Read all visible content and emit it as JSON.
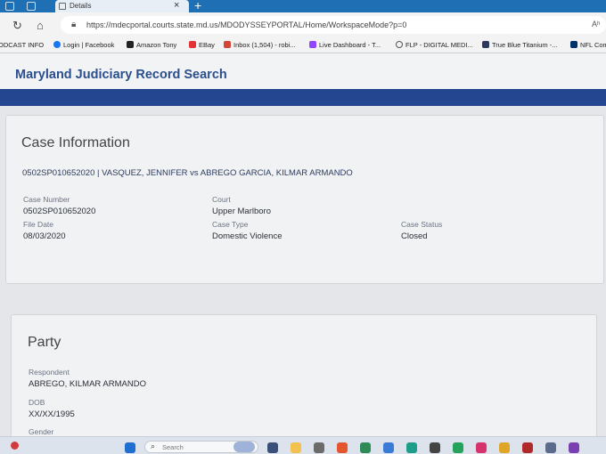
{
  "browser": {
    "tab_title": "Details",
    "tab_close": "×",
    "new_tab": "+",
    "url": "https://mdecportal.courts.state.md.us/MDODYSSEYPORTAL/Home/WorkspaceMode?p=0",
    "read_aloud": "Aʰ"
  },
  "bookmarks": [
    {
      "label": "ODCAST INFO",
      "icon": "podcast-icon",
      "color": "#999999"
    },
    {
      "label": "Login | Facebook",
      "icon": "facebook-icon",
      "color": "#1877f2"
    },
    {
      "label": "Amazon Tony",
      "icon": "amazon-icon",
      "color": "#222222"
    },
    {
      "label": "EBay",
      "icon": "ebay-icon",
      "color": "#e53238"
    },
    {
      "label": "Inbox (1,504) - robi...",
      "icon": "gmail-icon",
      "color": "#d44638"
    },
    {
      "label": "Live Dashboard - T...",
      "icon": "twitch-icon",
      "color": "#9146ff"
    },
    {
      "label": "FLP - DIGITAL MEDI...",
      "icon": "globe-icon",
      "color": "#555555"
    },
    {
      "label": "True Blue Titanium -...",
      "icon": "site-icon",
      "color": "#2b3a5e"
    },
    {
      "label": "NFL Com",
      "icon": "nfl-icon",
      "color": "#013369"
    }
  ],
  "site": {
    "title": "Maryland Judiciary Record Search"
  },
  "case_info": {
    "heading": "Case Information",
    "caption": "0502SP010652020 | VASQUEZ, JENNIFER vs ABREGO GARCIA, KILMAR ARMANDO",
    "case_number_label": "Case Number",
    "case_number": "0502SP010652020",
    "court_label": "Court",
    "court": "Upper Marlboro",
    "file_date_label": "File Date",
    "file_date": "08/03/2020",
    "case_type_label": "Case Type",
    "case_type": "Domestic Violence",
    "case_status_label": "Case Status",
    "case_status": "Closed"
  },
  "party": {
    "heading": "Party",
    "role_label": "Respondent",
    "name": "ABREGO, KILMAR ARMANDO",
    "dob_label": "DOB",
    "dob": "XX/XX/1995",
    "gender_label": "Gender"
  },
  "taskbar": {
    "search_placeholder": "Search"
  }
}
